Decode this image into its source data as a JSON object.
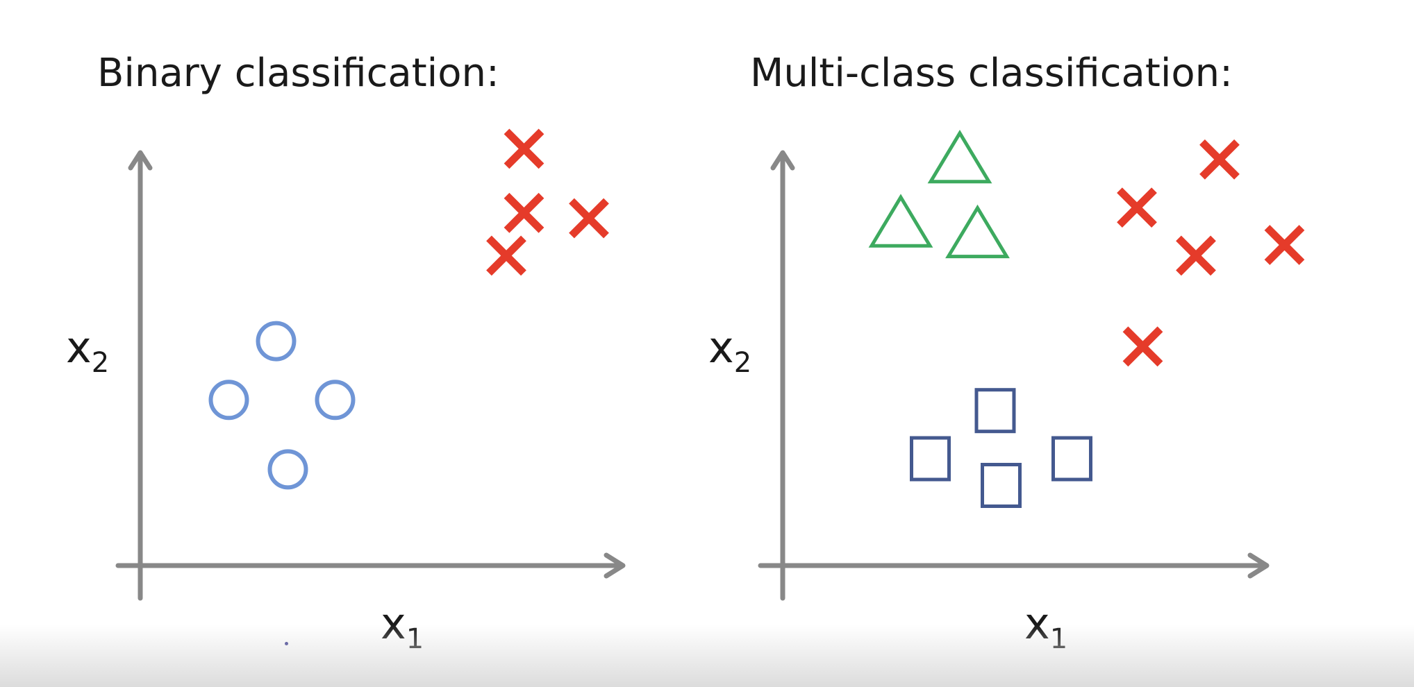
{
  "panels": [
    {
      "title": "Binary classification:",
      "x_label": "x",
      "x_sub": "1",
      "y_label": "x",
      "y_sub": "2",
      "classes": [
        {
          "shape": "circle",
          "color": "#6f95d6",
          "points": [
            [
              2.3,
              4.2
            ],
            [
              1.5,
              3.1
            ],
            [
              3.3,
              3.1
            ],
            [
              2.5,
              1.8
            ]
          ]
        },
        {
          "shape": "cross",
          "color": "#e53b2a",
          "points": [
            [
              6.5,
              7.8
            ],
            [
              6.5,
              6.6
            ],
            [
              7.6,
              6.5
            ],
            [
              6.2,
              5.8
            ]
          ]
        }
      ]
    },
    {
      "title": "Multi-class classification:",
      "x_label": "x",
      "x_sub": "1",
      "y_label": "x",
      "y_sub": "2",
      "classes": [
        {
          "shape": "triangle",
          "color": "#3daa5f",
          "points": [
            [
              3.0,
              7.6
            ],
            [
              2.0,
              6.4
            ],
            [
              3.3,
              6.2
            ]
          ]
        },
        {
          "shape": "square",
          "color": "#44598f",
          "points": [
            [
              3.6,
              2.9
            ],
            [
              2.5,
              2.0
            ],
            [
              4.9,
              2.0
            ],
            [
              3.7,
              1.5
            ]
          ]
        },
        {
          "shape": "cross",
          "color": "#e53b2a",
          "points": [
            [
              7.4,
              7.6
            ],
            [
              6.0,
              6.7
            ],
            [
              7.0,
              5.8
            ],
            [
              8.5,
              6.0
            ],
            [
              6.1,
              4.1
            ]
          ]
        }
      ]
    }
  ]
}
